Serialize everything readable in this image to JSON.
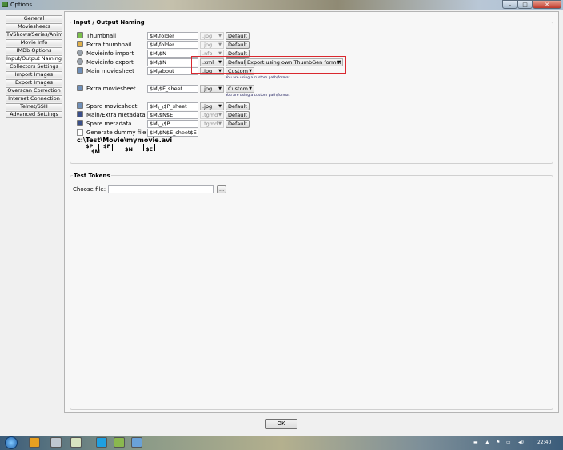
{
  "window": {
    "title": "Options",
    "min_glyph": "–",
    "max_glyph": "□",
    "close_glyph": "✕"
  },
  "sidebar": {
    "items": [
      "General",
      "Moviesheets",
      "TVShows/Series/Anime",
      "Movie Info",
      "IMDb Options",
      "Input/Output Naming",
      "Collectors Settings",
      "Import Images",
      "Export Images",
      "Overscan Correction",
      "Internet Connection",
      "Telnet/SSH",
      "Advanced Settings"
    ],
    "active_index": 5
  },
  "naming": {
    "title": "Input / Output Naming",
    "rows": [
      {
        "label": "Thumbnail",
        "icon": "image-icon",
        "path": "$M\\folder",
        "ext": ".jpg",
        "ext_enabled": false,
        "default_label": "Default"
      },
      {
        "label": "Extra thumbnail",
        "icon": "image-icon",
        "path": "$M\\folder",
        "ext": ".jpg",
        "ext_enabled": false,
        "default_label": "Default"
      },
      {
        "label": "Movieinfo import",
        "icon": "gear-icon",
        "path": "$M\\$N",
        "ext": ".nfo",
        "ext_enabled": false,
        "default_label": "Default"
      },
      {
        "label": "Movieinfo export",
        "icon": "gear-icon",
        "path": "$M\\$N",
        "ext": ".xml",
        "ext_enabled": true,
        "default_label": "Default",
        "format": "Export using own ThumbGen format"
      },
      {
        "label": "Main moviesheet",
        "icon": "sheet-icon",
        "path": "$M\\about",
        "ext": ".jpg",
        "ext_enabled": true,
        "custom": "Custom",
        "note": "You are using a custom path/format"
      },
      {
        "label": "Extra moviesheet",
        "icon": "sheet-icon",
        "path": "$M\\$F_sheet",
        "ext": ".jpg",
        "ext_enabled": true,
        "custom": "Custom",
        "note": "You are using a custom path/format"
      },
      {
        "label": "Spare moviesheet",
        "icon": "sheet-icon",
        "path": "$M\\_\\$P_sheet",
        "ext": ".jpg",
        "ext_enabled": true,
        "default_label": "Default"
      },
      {
        "label": "Main/Extra metadata",
        "icon": "metadata-icon",
        "path": "$M\\$N$E",
        "ext": ".tgmd",
        "ext_enabled": false,
        "default_label": "Default"
      },
      {
        "label": "Spare metadata",
        "icon": "metadata-icon",
        "path": "$M\\_\\$P",
        "ext": ".tgmd",
        "ext_enabled": false,
        "default_label": "Default"
      }
    ],
    "dummy": {
      "label": "Generate dummy file at",
      "path": "$M\\$N$E_sheet$E"
    }
  },
  "token_diagram": {
    "path": "c:\\Test\\Movie\\mymovie.avi",
    "tokens": [
      "$P",
      "$M",
      "$F",
      "$N",
      "$E"
    ]
  },
  "test_tokens": {
    "title": "Test Tokens",
    "choose_label": "Choose file:",
    "value": "",
    "browse_label": "..."
  },
  "ok_label": "OK",
  "tray": {
    "time": "22:40"
  },
  "colors": {
    "highlight": "#d9282f"
  }
}
